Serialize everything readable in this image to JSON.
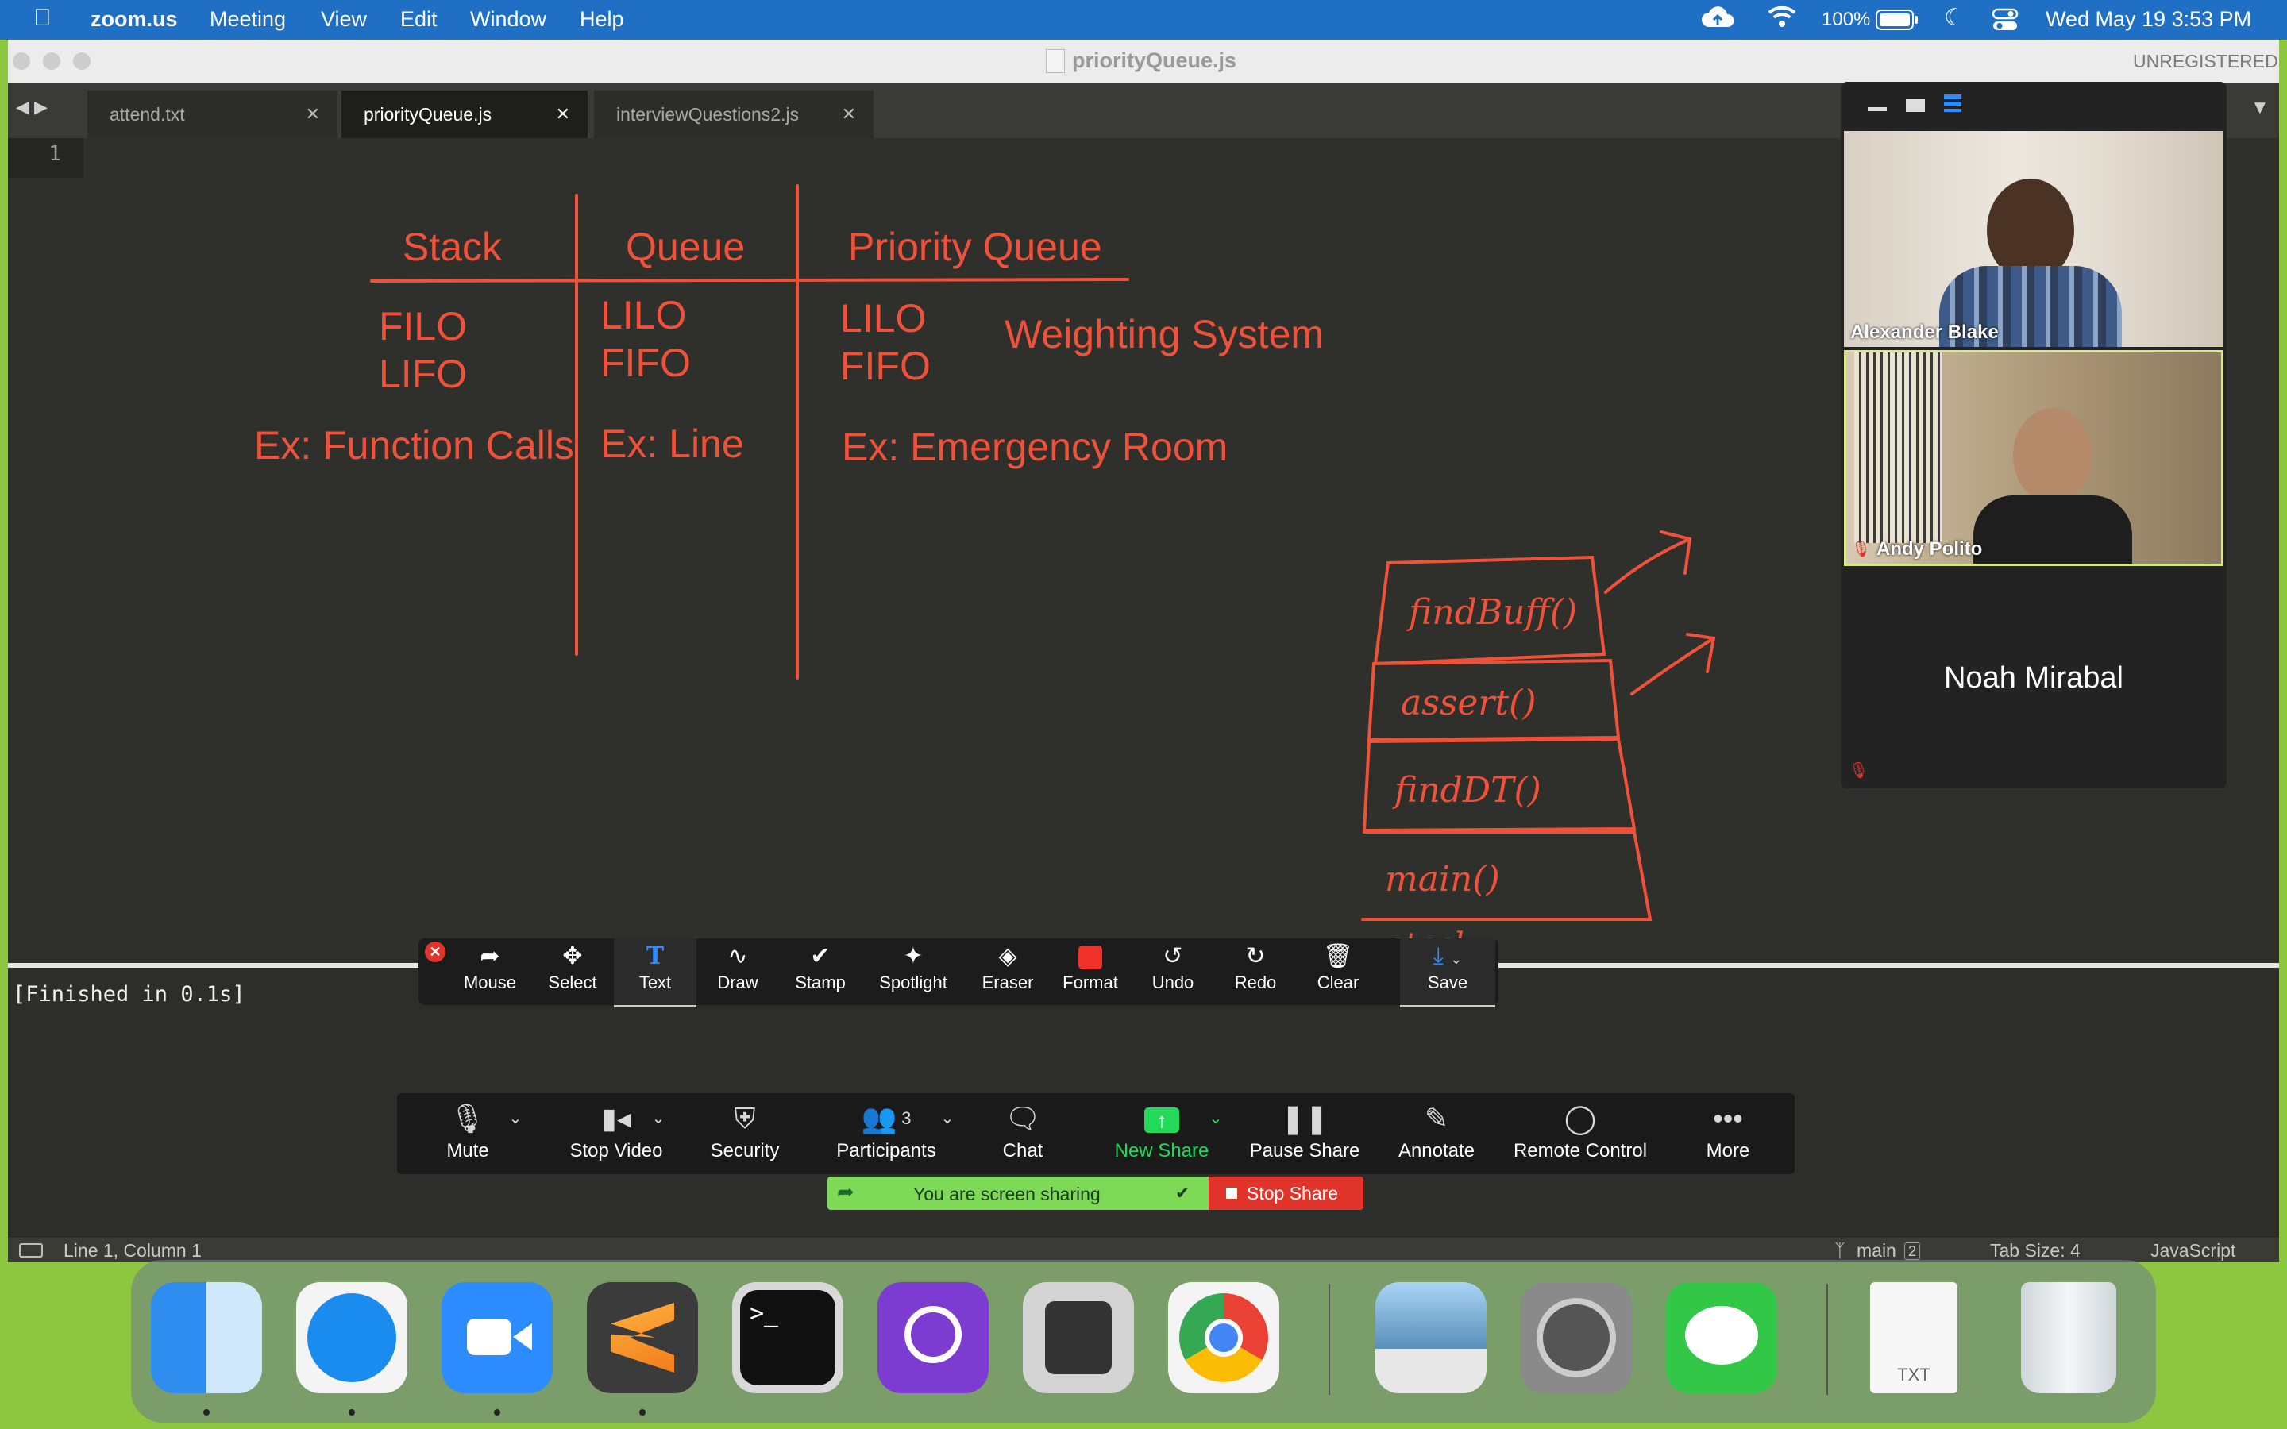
{
  "menubar": {
    "app": "zoom.us",
    "items": [
      "Meeting",
      "View",
      "Edit",
      "Window",
      "Help"
    ],
    "battery": "100%",
    "datetime": "Wed May 19  3:53 PM"
  },
  "window": {
    "title": "priorityQueue.js",
    "registration": "UNREGISTERED",
    "tabs": [
      {
        "label": "attend.txt",
        "active": false
      },
      {
        "label": "priorityQueue.js",
        "active": true
      },
      {
        "label": "interviewQuestions2.js",
        "active": false
      }
    ],
    "line_number": "1",
    "console_output": "[Finished in 0.1s]"
  },
  "annotations": {
    "headers": [
      "Stack",
      "Queue",
      "Priority Queue"
    ],
    "stack_lines": [
      "FILO",
      "LIFO"
    ],
    "queue_lines": [
      "LILO",
      "FIFO"
    ],
    "pq_lines": [
      "LILO",
      "FIFO"
    ],
    "weighting": "Weighting System",
    "examples": [
      "Ex: Function Calls",
      "Ex: Line",
      "Ex: Emergency Room"
    ],
    "stack_frames": [
      "findBuff()",
      "assert()",
      "findDT()",
      "main()"
    ],
    "stack_caption": "stack",
    "color": "#f0513a"
  },
  "annotate_toolbar": {
    "tools": [
      "Mouse",
      "Select",
      "Text",
      "Draw",
      "Stamp",
      "Spotlight",
      "Eraser",
      "Format",
      "Undo",
      "Redo",
      "Clear",
      "Save"
    ],
    "active": "Text"
  },
  "zoom_controls": {
    "mute": "Mute",
    "stop_video": "Stop Video",
    "security": "Security",
    "participants": "Participants",
    "participant_count": "3",
    "chat": "Chat",
    "new_share": "New Share",
    "pause_share": "Pause Share",
    "annotate": "Annotate",
    "remote_control": "Remote Control",
    "more": "More"
  },
  "share_banner": {
    "status": "You are screen sharing",
    "stop": "Stop Share"
  },
  "participants": [
    {
      "name": "Alexander Blake"
    },
    {
      "name": "Andy Polito"
    },
    {
      "name": "Noah Mirabal"
    }
  ],
  "statusbar": {
    "position": "Line 1, Column 1",
    "branch": "main",
    "branch_badge": "2",
    "tab_size": "Tab Size: 4",
    "syntax": "JavaScript"
  },
  "dock": {
    "apps": [
      "finder-icon",
      "safari-icon",
      "zoom-icon",
      "sublime-text-icon",
      "terminal-icon",
      "github-desktop-icon",
      "calculator-icon",
      "chrome-icon",
      "preview-icon",
      "system-preferences-icon",
      "messages-icon",
      "txt-document-icon",
      "trash-icon"
    ],
    "txt_label": "TXT"
  }
}
